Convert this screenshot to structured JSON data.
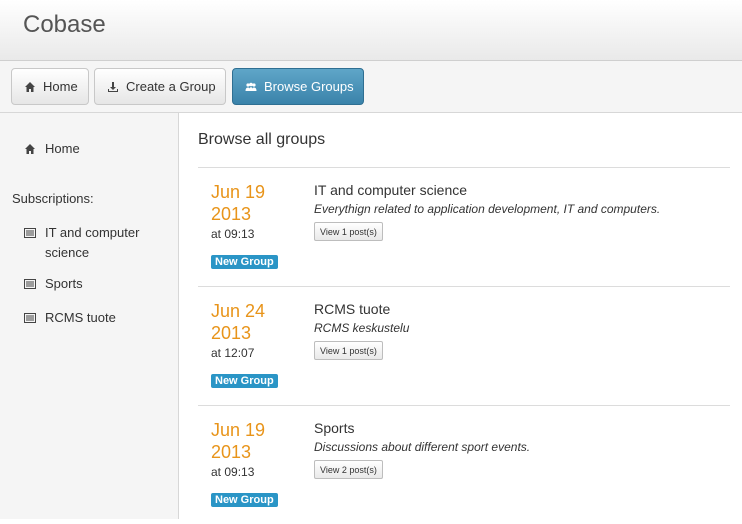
{
  "app": {
    "title": "Cobase"
  },
  "toolbar": {
    "home_label": "Home",
    "create_label": "Create a Group",
    "browse_label": "Browse Groups"
  },
  "sidebar": {
    "home_label": "Home",
    "subscriptions_header": "Subscriptions:",
    "items": [
      {
        "label": "IT and computer science"
      },
      {
        "label": "Sports"
      },
      {
        "label": "RCMS tuote"
      }
    ]
  },
  "main": {
    "heading": "Browse all groups",
    "groups": [
      {
        "date_line1": "Jun 19",
        "date_line2": "2013",
        "time": "at 09:13",
        "badge": "New Group",
        "name": "IT and computer science",
        "description": "Everythign related to application development, IT and computers.",
        "button": "View 1 post(s)"
      },
      {
        "date_line1": "Jun 24",
        "date_line2": "2013",
        "time": "at 12:07",
        "badge": "New Group",
        "name": "RCMS tuote",
        "description": "RCMS keskustelu",
        "button": "View 1 post(s)"
      },
      {
        "date_line1": "Jun 19",
        "date_line2": "2013",
        "time": "at 09:13",
        "badge": "New Group",
        "name": "Sports",
        "description": "Discussions about different sport events.",
        "button": "View 2 post(s)"
      }
    ]
  },
  "colors": {
    "accent": "#3a83aa",
    "date": "#e8941a",
    "badge": "#2a95c6"
  }
}
